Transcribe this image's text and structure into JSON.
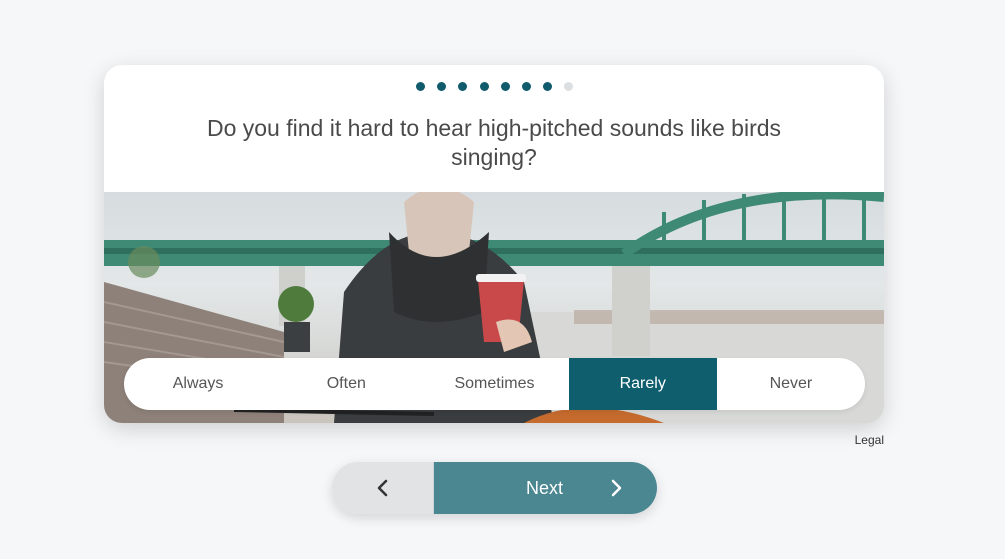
{
  "survey": {
    "progress": {
      "total_steps": 8,
      "completed_steps": 7
    },
    "question": "Do you find it hard to hear high-pitched sounds like birds singing?",
    "image_alt_icon": "woman-with-coffee-by-bridge-photo",
    "options": [
      "Always",
      "Often",
      "Sometimes",
      "Rarely",
      "Never"
    ],
    "selected_option": "Rarely"
  },
  "footer": {
    "legal_label": "Legal"
  },
  "navigation": {
    "back_icon": "chevron-left-icon",
    "next_label": "Next",
    "next_icon": "chevron-right-icon"
  },
  "colors": {
    "accent": "#0f5e6e",
    "next_button": "#4b8791",
    "back_button": "#e2e3e4",
    "dot_active": "#0f5a6b",
    "dot_inactive": "#dcdfe2"
  }
}
